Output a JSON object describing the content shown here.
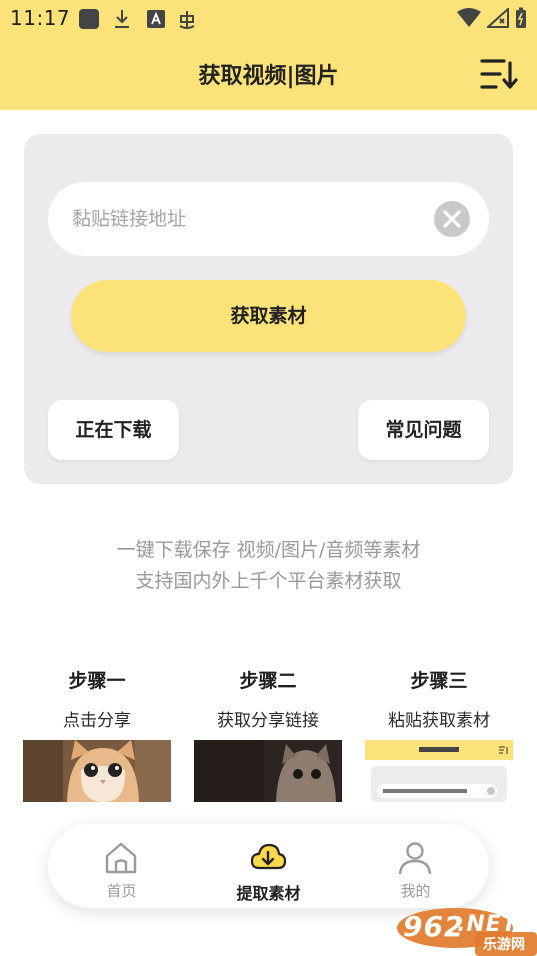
{
  "status_bar": {
    "time": "11:17"
  },
  "header": {
    "title": "获取视频|图片"
  },
  "input_card": {
    "link_placeholder": "黏贴链接地址",
    "link_value": "",
    "get_button_label": "获取素材",
    "downloading_button_label": "正在下载",
    "faq_button_label": "常见问题"
  },
  "description": {
    "line1": "一键下载保存 视频/图片/音频等素材",
    "line2": "支持国内外上千个平台素材获取"
  },
  "steps": [
    {
      "title": "步骤一",
      "desc": "点击分享"
    },
    {
      "title": "步骤二",
      "desc": "获取分享链接"
    },
    {
      "title": "步骤三",
      "desc": "粘贴获取素材"
    }
  ],
  "tabbar": {
    "items": [
      {
        "label": "首页",
        "icon": "home-icon"
      },
      {
        "label": "提取素材",
        "icon": "cloud-download-icon"
      },
      {
        "label": "我的",
        "icon": "user-icon"
      }
    ],
    "active_index": 1
  },
  "watermark": {
    "brand": "962",
    "tld": ".NET",
    "sub": "乐游网"
  },
  "colors": {
    "accent_yellow": "#fbe37a",
    "card_gray": "#ebebed",
    "muted_text": "#999999"
  }
}
